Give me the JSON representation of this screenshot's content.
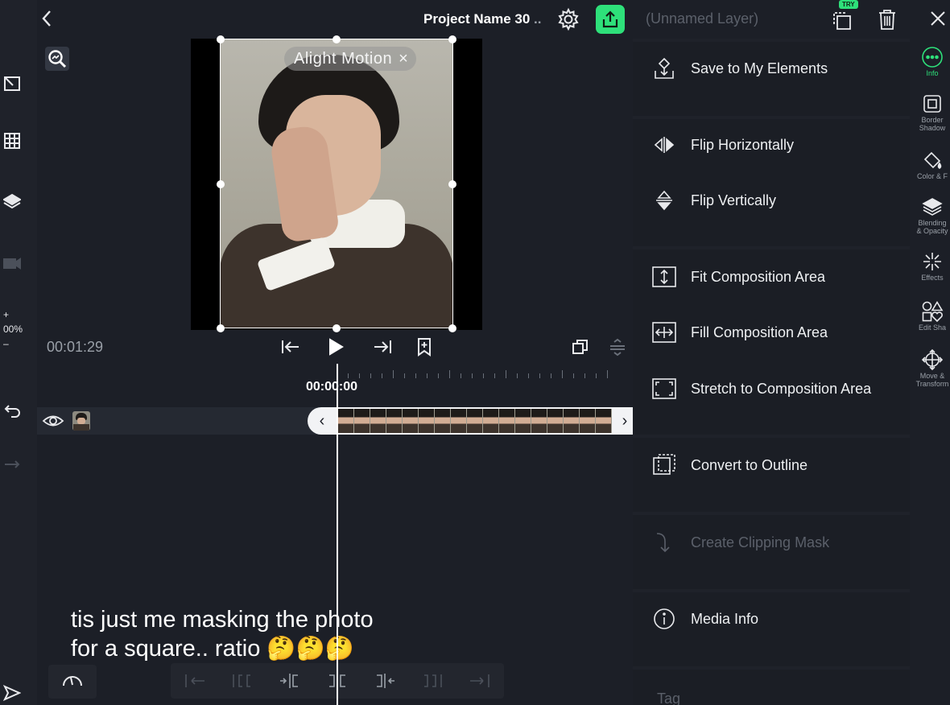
{
  "header": {
    "project_name": "Project Name 30",
    "project_more": "..",
    "accent_color": "#2ee07a"
  },
  "preview": {
    "watermark_text": "Alight Motion",
    "watermark_close": "×"
  },
  "left_rail": {
    "zoom_plus": "+",
    "zoom_value": "00%",
    "zoom_minus": "–"
  },
  "transport": {
    "total_time": "00:01:29"
  },
  "timeline": {
    "playhead_time": "00:00:00",
    "clip_prev": "‹",
    "clip_next": "›"
  },
  "caption": {
    "text": "tis just me masking the photo\nfor a square.. ratio 🤔🤔🤔"
  },
  "panel": {
    "layer_name": "(Unnamed Layer)",
    "try_badge": "TRY",
    "menu": {
      "save_to_elements": "Save to My Elements",
      "flip_horizontally": "Flip Horizontally",
      "flip_vertically": "Flip Vertically",
      "fit_composition": "Fit Composition Area",
      "fill_composition": "Fill Composition Area",
      "stretch_composition": "Stretch to Composition Area",
      "convert_outline": "Convert to Outline",
      "create_clipping_mask": "Create Clipping Mask",
      "media_info": "Media Info",
      "tag": "Tag"
    }
  },
  "prop_rail": {
    "close": "×",
    "items": [
      {
        "label": "Info"
      },
      {
        "label": "Border\nShadow"
      },
      {
        "label": "Color & F"
      },
      {
        "label": "Blending\n& Opacity"
      },
      {
        "label": "Effects"
      },
      {
        "label": "Edit Sha"
      },
      {
        "label": "Move &\nTransform"
      }
    ]
  }
}
